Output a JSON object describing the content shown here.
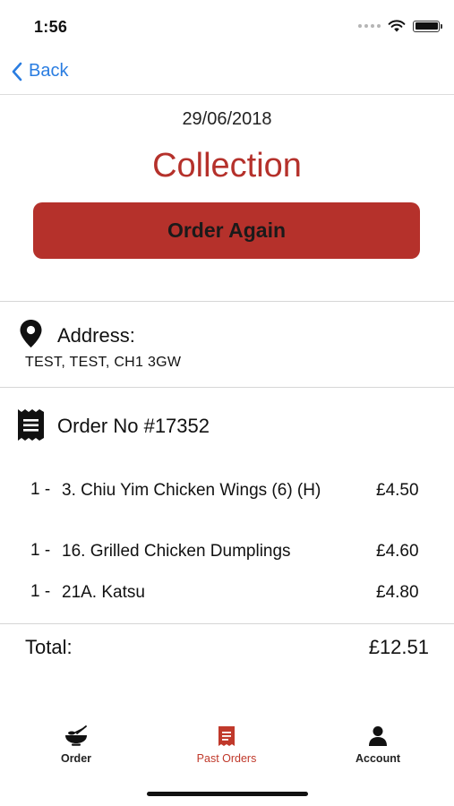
{
  "status_bar": {
    "time": "1:56"
  },
  "nav": {
    "back_label": "Back"
  },
  "order": {
    "date": "29/06/2018",
    "type": "Collection",
    "order_again_label": "Order Again"
  },
  "address": {
    "title": "Address:",
    "value": "TEST, TEST, CH1 3GW"
  },
  "order_number": "Order No #17352",
  "items": [
    {
      "qty": "1 -",
      "name": "3. Chiu Yim Chicken Wings (6) (H)",
      "price": "£4.50"
    },
    {
      "qty": "1 -",
      "name": "16. Grilled Chicken Dumplings",
      "price": "£4.60"
    },
    {
      "qty": "1 -",
      "name": "21A. Katsu",
      "price": "£4.80"
    }
  ],
  "total": {
    "label": "Total:",
    "value": "£12.51"
  },
  "tabs": [
    {
      "label": "Order",
      "icon": "bowl-icon",
      "active": false
    },
    {
      "label": "Past Orders",
      "icon": "receipt-icon",
      "active": true
    },
    {
      "label": "Account",
      "icon": "person-icon",
      "active": false
    }
  ],
  "colors": {
    "accent": "#b5312b",
    "link": "#2a7de1"
  }
}
